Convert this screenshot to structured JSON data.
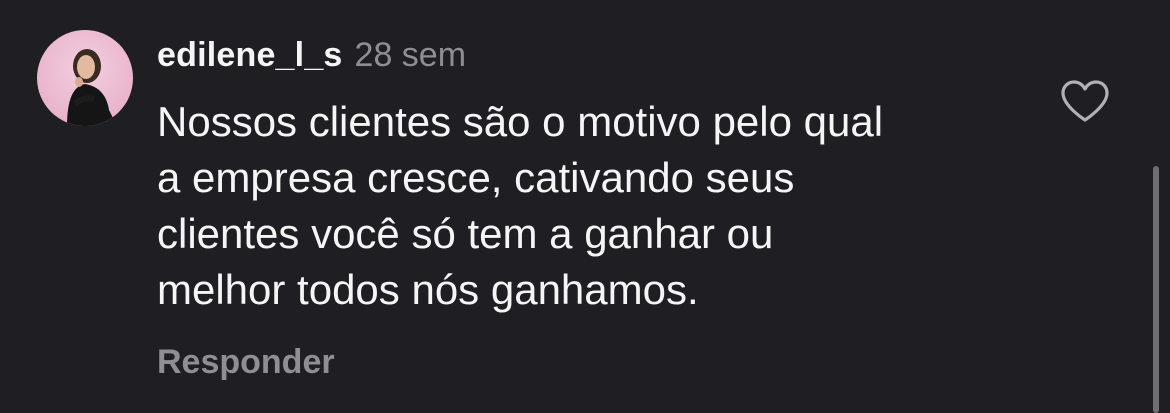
{
  "comment": {
    "username": "edilene_l_s",
    "timestamp": "28 sem",
    "text_lines": [
      "Nossos clientes são o motivo pelo qual",
      "a empresa cresce, cativando seus",
      "clientes você só tem a ganhar ou",
      "melhor todos nós ganhamos."
    ],
    "reply_label": "Responder",
    "like_icon": "heart-outline-icon"
  },
  "colors": {
    "background": "#1f1f23",
    "primary_text": "#f5f5f5",
    "secondary_text": "#8e8e93",
    "avatar_bg": "#e9b4cc"
  }
}
